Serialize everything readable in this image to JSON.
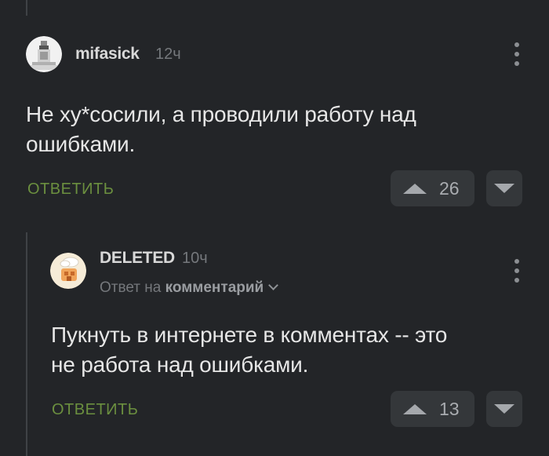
{
  "comments": [
    {
      "username": "mifasick",
      "time": "12ч",
      "text_line1": "Не ху*сосили, а проводили работу над",
      "text_line2": "ошибками.",
      "reply_label": "ОТВЕТИТЬ",
      "votes": "26"
    },
    {
      "username": "DELETED",
      "time": "10ч",
      "reply_to_prefix": "Ответ на",
      "reply_to_target": "комментарий",
      "text_line1": "Пукнуть в интернете в комментах -- это",
      "text_line2": "не работа над ошибками.",
      "reply_label": "ОТВЕТИТЬ",
      "votes": "13"
    }
  ]
}
